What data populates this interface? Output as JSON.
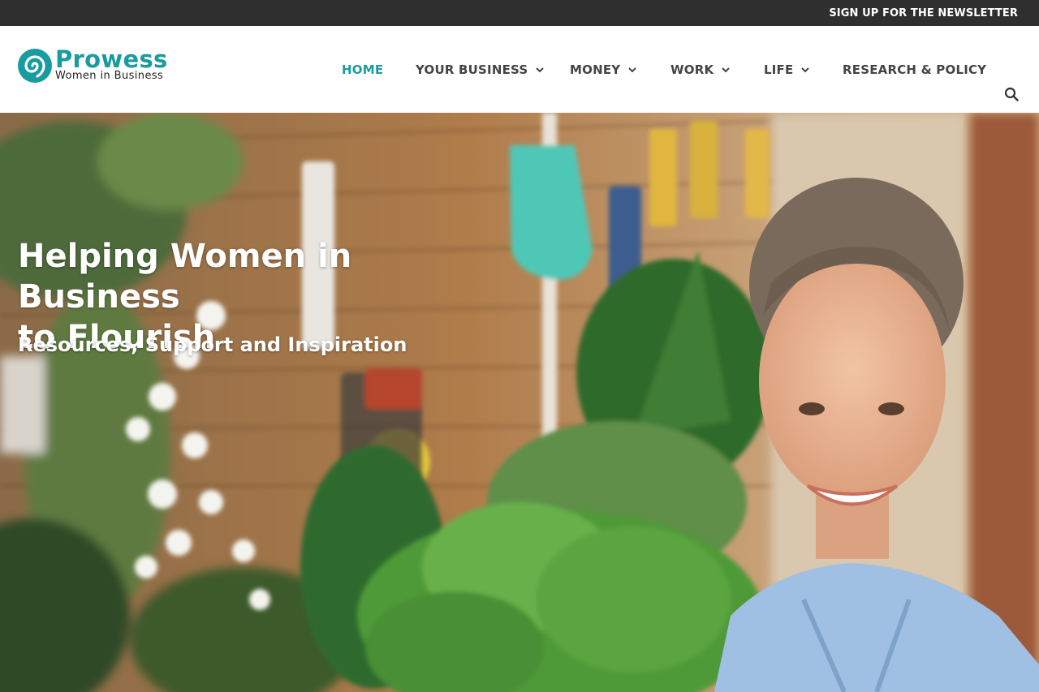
{
  "topbar": {
    "newsletter_label": "SIGN UP FOR THE NEWSLETTER"
  },
  "logo": {
    "name": "Prowess",
    "tagline": "Women in Business",
    "icon": "spiral-logo-icon"
  },
  "nav": {
    "items": [
      {
        "label": "HOME",
        "active": true,
        "has_dropdown": false
      },
      {
        "label": "YOUR BUSINESS",
        "active": false,
        "has_dropdown": true
      },
      {
        "label": "MONEY",
        "active": false,
        "has_dropdown": true
      },
      {
        "label": "WORK",
        "active": false,
        "has_dropdown": true
      },
      {
        "label": "LIFE",
        "active": false,
        "has_dropdown": true
      },
      {
        "label": "RESEARCH & POLICY",
        "active": false,
        "has_dropdown": false
      }
    ],
    "search_icon": "search-icon"
  },
  "hero": {
    "title_line1": "Helping Women in Business",
    "title_line2": "to Flourish",
    "subtitle": "Resources, Support and Inspiration"
  },
  "colors": {
    "brand": "#1a9ba0",
    "topbar_bg": "#2f2f2f",
    "nav_text": "#444444"
  }
}
